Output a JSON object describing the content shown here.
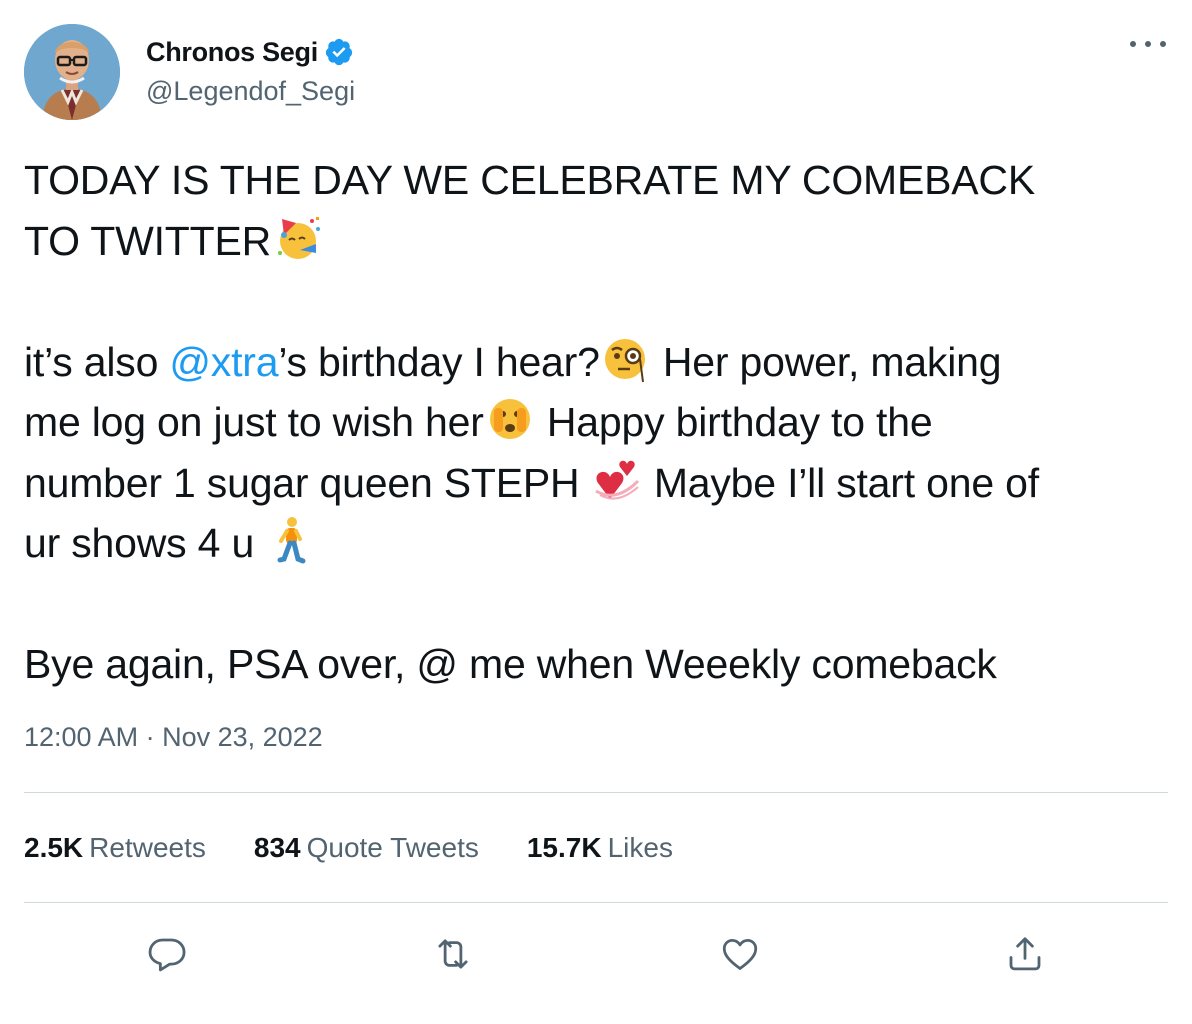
{
  "author": {
    "display_name": "Chronos Segi",
    "handle": "@Legendof_Segi",
    "verified": true
  },
  "tweet": {
    "line1a": "TODAY IS THE DAY WE CELEBRATE MY COMEBACK",
    "line1b": "TO TWITTER",
    "p2_pre": "it’s also ",
    "p2_mention": "@xtra",
    "p2_post": "’s birthday I hear?",
    "p2_after_monocle": " Her power, making",
    "p2_line2": "me log on just to wish her",
    "p2_after_peek": "  Happy birthday to the",
    "p2_line3": "number 1 sugar queen STEPH ",
    "p2_after_hearts": " Maybe I’ll start one of",
    "p2_line4": "ur shows 4 u ",
    "p3": "Bye again, PSA over, @ me when Weeekly comeback"
  },
  "emojis": {
    "party": "partying-face-emoji",
    "monocle": "face-with-monocle-emoji",
    "peek": "face-with-open-eyes-and-hand-over-mouth-emoji",
    "hearts": "revolving-hearts-emoji",
    "walking": "person-walking-emoji"
  },
  "timestamp": "12:00 AM · Nov 23, 2022",
  "stats": {
    "retweets_count": "2.5K",
    "retweets_label": "Retweets",
    "quotes_count": "834",
    "quotes_label": "Quote Tweets",
    "likes_count": "15.7K",
    "likes_label": "Likes"
  },
  "actions": [
    "reply-icon",
    "retweet-icon",
    "like-icon",
    "share-icon"
  ],
  "colors": {
    "accent": "#1d9bf0",
    "secondary_text": "#536471",
    "divider": "#cfd9de"
  }
}
